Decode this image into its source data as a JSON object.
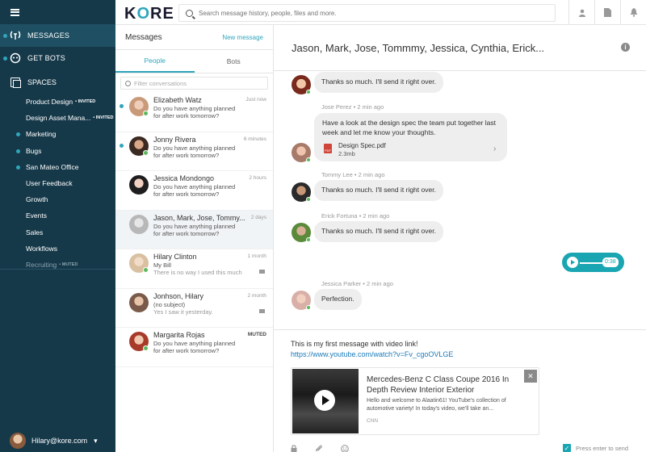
{
  "sidebar": {
    "nav": [
      {
        "label": "MESSAGES",
        "icon": "messages-icon"
      },
      {
        "label": "GET BOTS",
        "icon": "bots-icon"
      }
    ],
    "spaces_label": "SPACES",
    "spaces": [
      {
        "label": "Product Design",
        "tag": "• INVITED",
        "dot": false,
        "muted": false
      },
      {
        "label": "Design Asset Mana...",
        "tag": "• INVITED",
        "dot": false,
        "muted": false
      },
      {
        "label": "Marketing",
        "tag": "",
        "dot": true,
        "muted": false
      },
      {
        "label": "Bugs",
        "tag": "",
        "dot": true,
        "muted": false
      },
      {
        "label": "San Mateo Office",
        "tag": "",
        "dot": true,
        "muted": false
      },
      {
        "label": "User Feedback",
        "tag": "",
        "dot": false,
        "muted": false
      },
      {
        "label": "Growth",
        "tag": "",
        "dot": false,
        "muted": false
      },
      {
        "label": "Events",
        "tag": "",
        "dot": false,
        "muted": false
      },
      {
        "label": "Sales",
        "tag": "",
        "dot": false,
        "muted": false
      },
      {
        "label": "Workflows",
        "tag": "",
        "dot": false,
        "muted": false
      },
      {
        "label": "Recruiting",
        "tag": "• MUTED",
        "dot": false,
        "muted": true
      }
    ],
    "user_email": "Hilary@kore.com"
  },
  "topbar": {
    "logo": "KORE",
    "search_placeholder": "Search message history, people, files and more."
  },
  "list": {
    "title": "Messages",
    "new_message": "New message",
    "tabs": [
      "People",
      "Bots"
    ],
    "filter_placeholder": "Filter conversations",
    "conversations": [
      {
        "name": "Elizabeth Watz",
        "time": "Just now",
        "l1": "Do you have anything planned",
        "l2": "for after work tomorrow?",
        "unread": true,
        "online": true
      },
      {
        "name": "Jonny Rivera",
        "time": "6 minutes",
        "l1": "Do you have anything planned",
        "l2": "for after work tomorrow?",
        "unread": true,
        "online": true
      },
      {
        "name": "Jessica Mondongo",
        "time": "2 hours",
        "l1": "Do you have anything planned",
        "l2": "for after work tomorrow?",
        "unread": false,
        "online": false
      },
      {
        "name": "Jason, Mark, Jose, Tommy...",
        "time": "2 days",
        "l1": "Do you have anything planned",
        "l2": "for after work tomorrow?",
        "unread": false,
        "online": false
      },
      {
        "name": "Hilary Clinton",
        "time": "1 month",
        "l1": "My Bill",
        "l2": "There is no way I used this much",
        "unread": false,
        "online": true
      },
      {
        "name": "Jonhson, Hilary",
        "time": "2 month",
        "l1": "(no subject)",
        "l2": "Yes I saw it yesterday.",
        "unread": false,
        "online": false
      },
      {
        "name": "Margarita Rojas",
        "time": "MUTED",
        "l1": "Do you have anything planned",
        "l2": "for after work tomorrow?",
        "unread": false,
        "online": true
      }
    ]
  },
  "chat": {
    "title": "Jason, Mark, Jose, Tommmy, Jessica, Cynthia, Erick...",
    "messages": [
      {
        "text": "Thanks so much. I'll send it right over."
      },
      {
        "sender": "Jose Perez",
        "time": "2 min ago",
        "text": "Have a look at the design spec the team put together last week and let me know your thoughts.",
        "file_name": "Design Spec.pdf",
        "file_size": "2.3mb",
        "file_badge": "PDF"
      },
      {
        "sender": "Tommy Lee",
        "time": "2 min ago",
        "text": "Thanks so much. I'll send it right over."
      },
      {
        "sender": "Erick Fortuna",
        "time": "2 min ago",
        "text": "Thanks so much. I'll send it right over."
      },
      {
        "sender": "Jessica Parker",
        "time": "2 min ago",
        "text": "Perfection."
      }
    ],
    "voice_duration": "0:38",
    "composer": {
      "text": "This is my first message with video link!",
      "link": "https://www.youtube.com/watch?v=Fv_cgoOVLGE",
      "card_title": "Mercedes-Benz C Class Coupe 2016 In Depth Review Interior Exterior",
      "card_desc": "Hello and welcome to Alaatin61! YouTube's collection of automotive variety! In today's video, we'll take an...",
      "card_source": "CNN",
      "enter_label": "Press enter to send"
    }
  },
  "colors": {
    "accent": "#2fa6bb",
    "sidebar": "#16394a",
    "online": "#5cb85c"
  }
}
